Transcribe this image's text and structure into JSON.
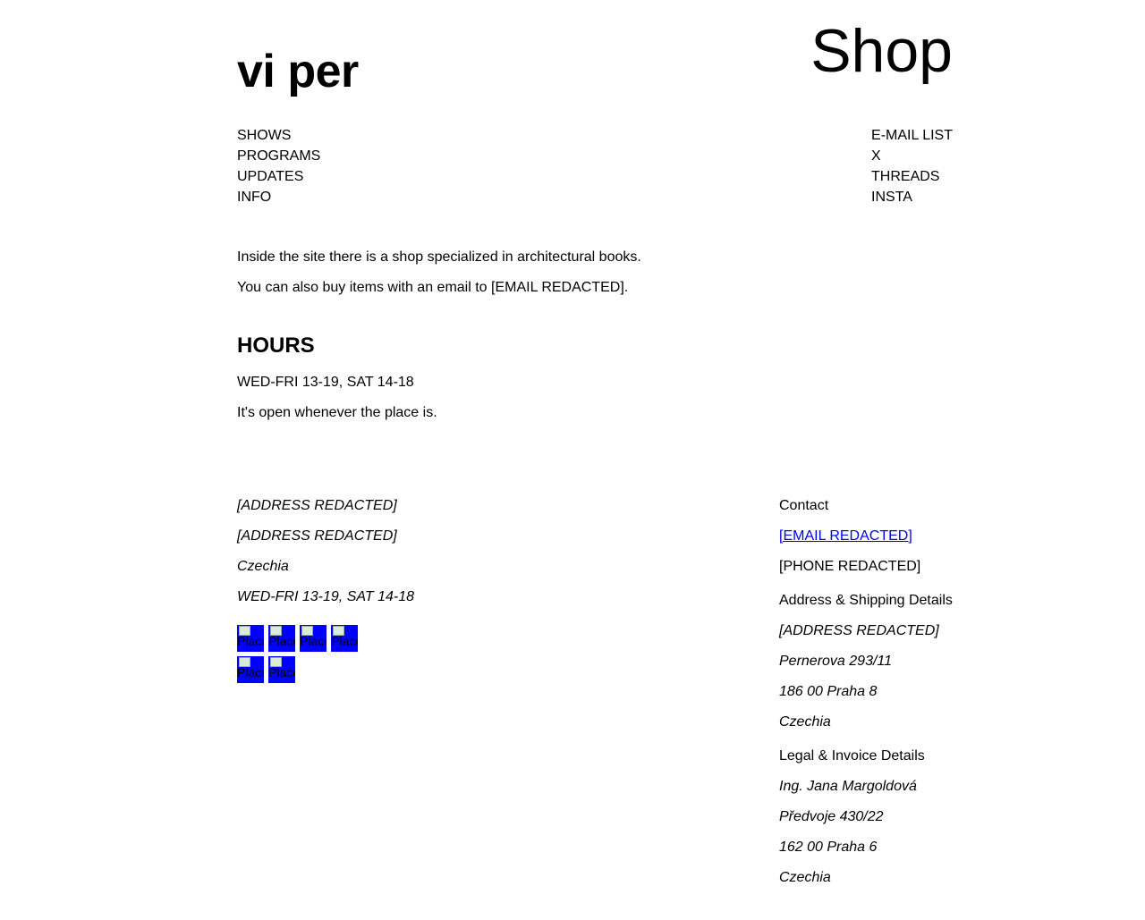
{
  "header": {
    "logo": "vi per",
    "page_title": "Shop"
  },
  "nav_left": [
    "SHOWS",
    "PROGRAMS",
    "UPDATES",
    "INFO"
  ],
  "nav_right": [
    "E-MAIL LIST",
    "X",
    "THREADS",
    "INSTA"
  ],
  "intro": {
    "line1": "Inside the site there is a shop specialized in architectural books.",
    "line2": "You can also buy items with an email to [EMAIL REDACTED]."
  },
  "hours": {
    "title": "HOURS",
    "schedule": "WED-FRI 13-19, SAT 14-18",
    "note": "It's open whenever the place is."
  },
  "footer_left": {
    "address1": "[ADDRESS REDACTED]",
    "address2": "[ADDRESS REDACTED]",
    "country": "Czechia",
    "hours": "WED-FRI 13-19, SAT 14-18",
    "thumb_alt": "Placeholder",
    "thumb_color": "#0000ff"
  },
  "footer_right": {
    "contact_heading": "Contact",
    "email": "[EMAIL REDACTED]",
    "phone": "[PHONE REDACTED]",
    "shipping_heading": "Address & Shipping Details",
    "shipping_lines": [
      "[ADDRESS REDACTED]",
      "Pernerova 293/11",
      "186 00 Praha 8",
      "Czechia"
    ],
    "legal_heading": "Legal & Invoice Details",
    "legal_lines": [
      "Ing. Jana Margoldová",
      "Předvoje 430/22",
      "162 00 Praha 6",
      "Czechia"
    ]
  }
}
